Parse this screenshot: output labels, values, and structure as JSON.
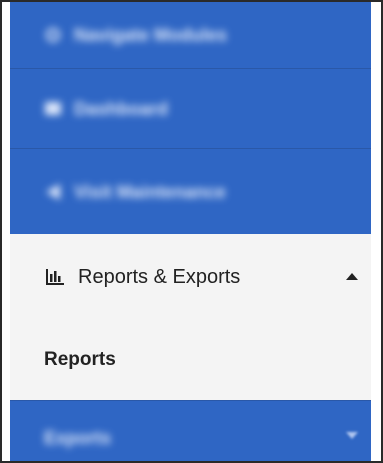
{
  "nav": {
    "items": [
      {
        "label": "Navigate Modules",
        "icon": "search-icon"
      },
      {
        "label": "Dashboard",
        "icon": "dashboard-icon"
      },
      {
        "label": "Visit Maintenance",
        "icon": "megaphone-icon"
      },
      {
        "label": "Reports & Exports",
        "icon": "bar-chart-icon",
        "expanded": true,
        "caret": "chevron-up-icon"
      },
      {
        "label": "Reports",
        "submenu_item": true
      },
      {
        "label": "Exports",
        "caret": "chevron-down-icon",
        "expanded": false
      }
    ]
  },
  "colors": {
    "sidebar_blue": "#2f66c4",
    "active_background": "#f4f4f4",
    "active_text": "#222222",
    "frame_border": "#2a2a2a"
  }
}
